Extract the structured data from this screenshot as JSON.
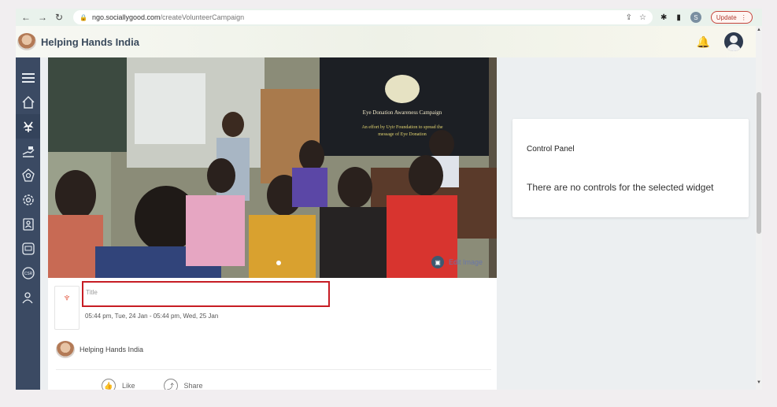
{
  "browser": {
    "url_host": "ngo.sociallygood.com",
    "url_path": "/createVolunteerCampaign",
    "profile_initial": "S",
    "update_label": "Update"
  },
  "header": {
    "app_title": "Helping Hands India"
  },
  "sidebar": {
    "items": [
      {
        "icon": "menu-icon"
      },
      {
        "icon": "home-icon"
      },
      {
        "icon": "volunteer-icon",
        "active": true
      },
      {
        "icon": "donate-icon"
      },
      {
        "icon": "badge-icon"
      },
      {
        "icon": "settings-icon"
      },
      {
        "icon": "contacts-icon"
      },
      {
        "icon": "ngo-icon"
      },
      {
        "icon": "csr-icon"
      },
      {
        "icon": "people-icon"
      }
    ]
  },
  "campaign": {
    "projected_slide_title": "Eye Donation Awareness Campaign",
    "projected_slide_subtitle_line1": "An effort by Uyir Foundation to spread the",
    "projected_slide_subtitle_line2": "message of Eye Donation",
    "edit_image_label": "Edit Image",
    "title_placeholder": "Title",
    "date_range": "05:44 pm, Tue, 24 Jan - 05:44 pm, Wed, 25 Jan",
    "owner_name": "Helping Hands India",
    "like_label": "Like",
    "share_label": "Share"
  },
  "control_panel": {
    "title": "Control Panel",
    "message": "There are no controls for the selected widget"
  }
}
